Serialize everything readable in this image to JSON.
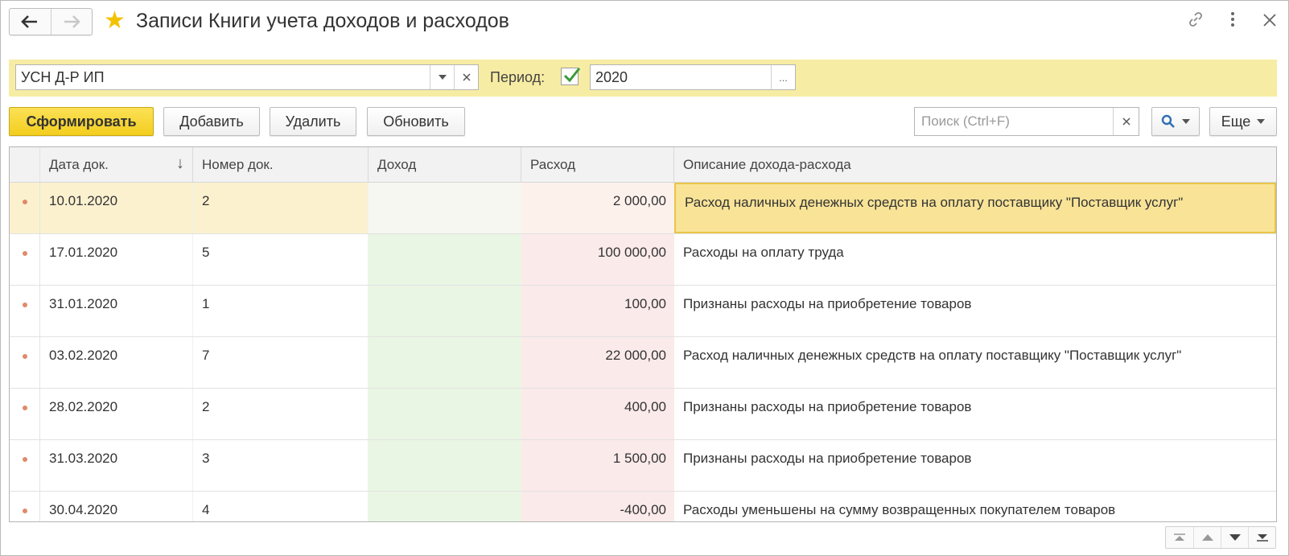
{
  "window": {
    "title": "Записи Книги учета доходов и расходов",
    "nav": {
      "back": "🡐",
      "forward": "🡒"
    },
    "icons": {
      "favorite": "star-icon",
      "link": "link-icon",
      "menu": "more-vertical-icon",
      "close": "close-icon"
    }
  },
  "filter": {
    "organization": "УСН Д-Р ИП",
    "period_label": "Период:",
    "period_enabled": true,
    "period_value": "2020",
    "dots": "..."
  },
  "toolbar": {
    "generate": "Сформировать",
    "add": "Добавить",
    "delete": "Удалить",
    "refresh": "Обновить",
    "search_placeholder": "Поиск (Ctrl+F)",
    "more": "Еще"
  },
  "table": {
    "columns": {
      "date": "Дата док.",
      "number": "Номер док.",
      "income": "Доход",
      "expense": "Расход",
      "description": "Описание дохода-расхода"
    },
    "sort_indicator": "↓",
    "rows": [
      {
        "date": "10.01.2020",
        "number": "2",
        "income": "",
        "expense": "2 000,00",
        "description": "Расход наличных денежных средств на оплату поставщику \"Поставщик услуг\""
      },
      {
        "date": "17.01.2020",
        "number": "5",
        "income": "",
        "expense": "100 000,00",
        "description": "Расходы на оплату труда"
      },
      {
        "date": "31.01.2020",
        "number": "1",
        "income": "",
        "expense": "100,00",
        "description": "Признаны расходы на приобретение товаров"
      },
      {
        "date": "03.02.2020",
        "number": "7",
        "income": "",
        "expense": "22 000,00",
        "description": "Расход наличных денежных средств на оплату поставщику \"Поставщик услуг\""
      },
      {
        "date": "28.02.2020",
        "number": "2",
        "income": "",
        "expense": "400,00",
        "description": "Признаны расходы на приобретение товаров"
      },
      {
        "date": "31.03.2020",
        "number": "3",
        "income": "",
        "expense": "1 500,00",
        "description": "Признаны расходы на приобретение товаров"
      },
      {
        "date": "30.04.2020",
        "number": "4",
        "income": "",
        "expense": "-400,00",
        "description": "Расходы уменьшены на сумму возвращенных покупателем товаров"
      }
    ]
  },
  "colors": {
    "accent_yellow": "#f3cd1e",
    "filter_bg": "#f7eca3",
    "income_bg": "#eaf6e4",
    "expense_bg": "#fbeaea",
    "selected_row": "#fbf1cf"
  }
}
